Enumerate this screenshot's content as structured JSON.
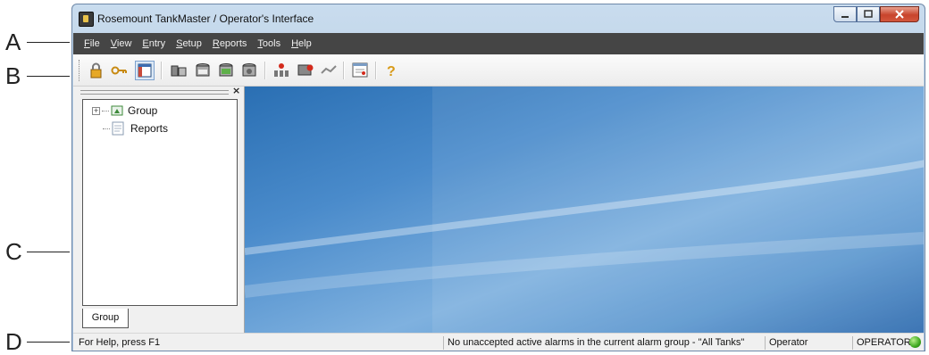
{
  "callouts": {
    "a": "A",
    "b": "B",
    "c": "C",
    "d": "D"
  },
  "window": {
    "title": "Rosemount TankMaster / Operator's Interface"
  },
  "menubar": {
    "items": [
      {
        "first": "F",
        "rest": "ile"
      },
      {
        "first": "V",
        "rest": "iew"
      },
      {
        "first": "E",
        "rest": "ntry"
      },
      {
        "first": "S",
        "rest": "etup"
      },
      {
        "first": "R",
        "rest": "eports"
      },
      {
        "first": "T",
        "rest": "ools"
      },
      {
        "first": "H",
        "rest": "elp"
      }
    ]
  },
  "toolbar": {
    "icons": [
      "lock-icon",
      "key-icon",
      "workspace-view-icon",
      "tank-view-icon",
      "tank-group-icon",
      "tank-green-icon",
      "tank-config-icon",
      "alarm-tanks-icon",
      "alarm-summary-icon",
      "alarm-mute-icon",
      "report-icon",
      "help-icon"
    ]
  },
  "left_pane": {
    "close_glyph": "×",
    "tree": [
      {
        "label": "Group",
        "expander": "+"
      },
      {
        "label": "Reports"
      }
    ],
    "tab_label": "Group"
  },
  "statusbar": {
    "help": "For Help, press F1",
    "alarm": "No unaccepted active alarms in the current alarm group - \"All Tanks\"",
    "role": "Operator",
    "user": "OPERATOR",
    "led_color": "#3ea81e"
  },
  "colors": {
    "menubar": "#454545",
    "workspace": "#4a8bcb",
    "accent": "#7da2ce"
  }
}
